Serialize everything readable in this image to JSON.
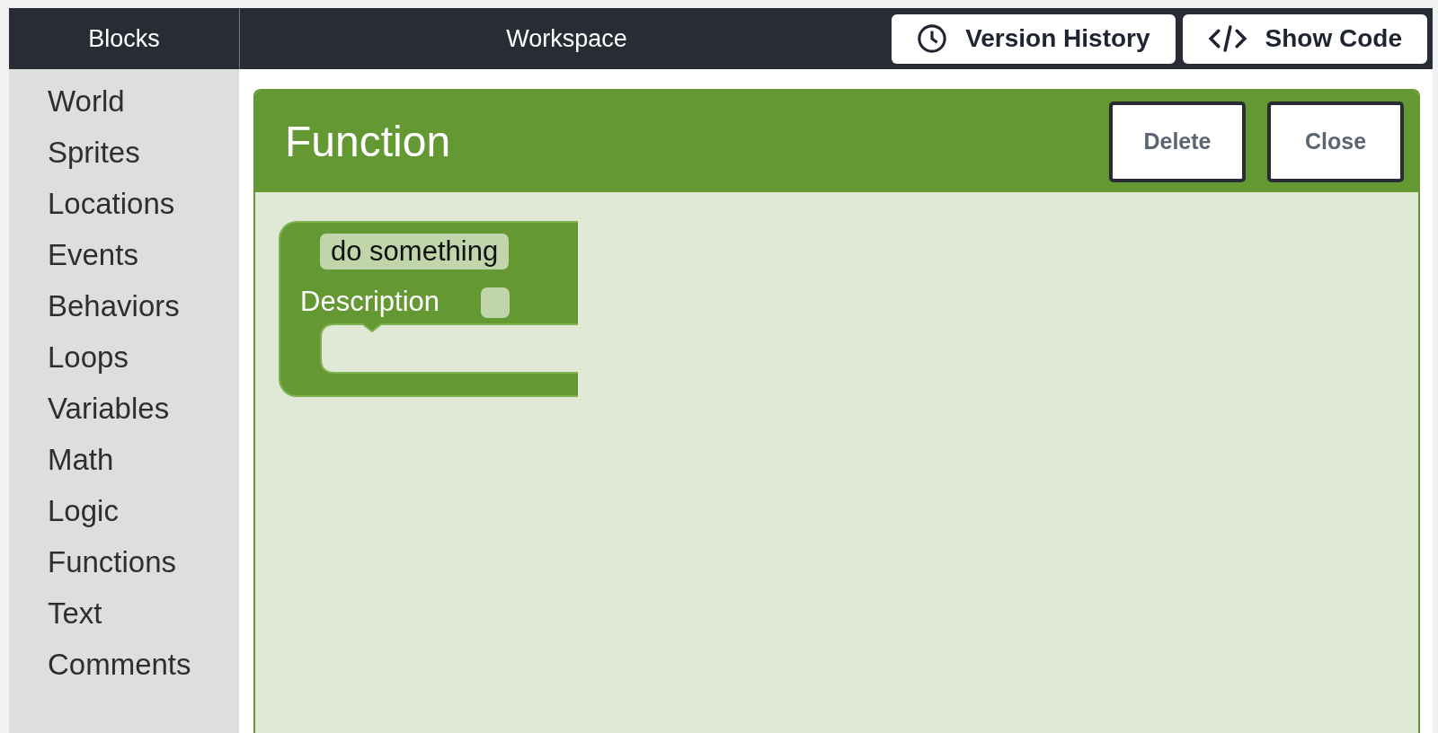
{
  "header": {
    "blocks_title": "Blocks",
    "workspace_title": "Workspace",
    "buttons": [
      {
        "label": "Version History",
        "kind": "history"
      },
      {
        "label": "Show Code",
        "kind": "code"
      }
    ]
  },
  "sidebar": {
    "items": [
      "World",
      "Sprites",
      "Locations",
      "Events",
      "Behaviors",
      "Loops",
      "Variables",
      "Math",
      "Logic",
      "Functions",
      "Text",
      "Comments"
    ]
  },
  "panel": {
    "title": "Function",
    "buttons": [
      "Delete",
      "Close"
    ],
    "block": {
      "name": "do something",
      "field_label": "Description",
      "checked": false
    }
  }
}
